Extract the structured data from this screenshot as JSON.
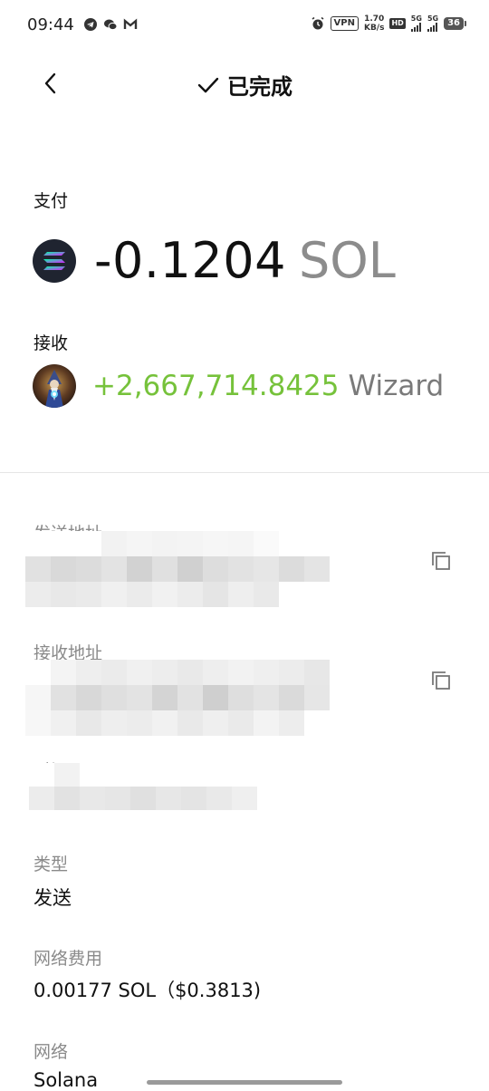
{
  "status_bar": {
    "time": "09:44",
    "vpn": "VPN",
    "speed_value": "1.70",
    "speed_unit": "KB/s",
    "hd": "HD",
    "net1": "5G",
    "net2": "5G",
    "battery": "36"
  },
  "header": {
    "title": "已完成",
    "icons": {
      "back": "chevron-left-icon",
      "status": "checkmark-icon"
    }
  },
  "payment": {
    "label": "支付",
    "amount": "-0.1204",
    "unit": "SOL"
  },
  "receive": {
    "label": "接收",
    "amount": "+2,667,714.8425",
    "unit": "Wizard"
  },
  "details": {
    "from_label": "发送地址",
    "to_label": "接收地址",
    "time_label": "时间",
    "type_label": "类型",
    "type_value": "发送",
    "fee_label": "网络费用",
    "fee_value": "0.00177 SOL（$0.3813)",
    "network_label": "网络",
    "network_value": "Solana"
  },
  "colors": {
    "positive": "#76c23b",
    "unit_gray": "#8c8c8c",
    "label_gray": "#8a8a8a"
  }
}
